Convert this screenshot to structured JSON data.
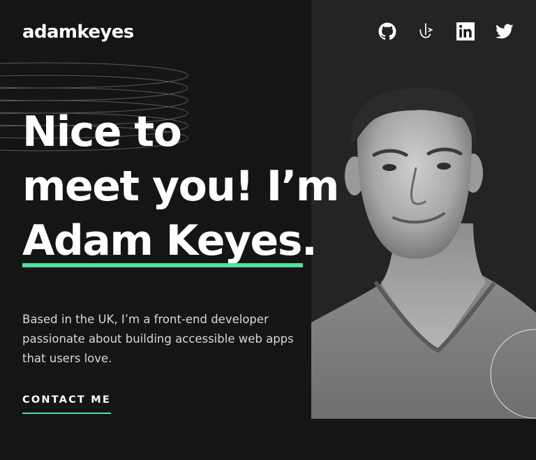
{
  "header": {
    "logo": "adamkeyes",
    "social_links": [
      {
        "name": "GitHub",
        "icon": "github-icon"
      },
      {
        "name": "Frontend Mentor",
        "icon": "frontend-mentor-icon"
      },
      {
        "name": "LinkedIn",
        "icon": "linkedin-icon"
      },
      {
        "name": "Twitter",
        "icon": "twitter-icon"
      }
    ]
  },
  "hero": {
    "headline_line1": "Nice to",
    "headline_line2": "meet you! I’m",
    "headline_name": "Adam Keyes",
    "headline_period": ".",
    "bio": "Based in the UK, I’m a front-end developer passionate about building accessible web apps that users love.",
    "cta_label": "CONTACT ME"
  },
  "colors": {
    "background": "#151515",
    "portrait_bg": "#242424",
    "accent": "#4ee1a0",
    "text": "#ffffff",
    "muted_text": "#d9d9d9"
  }
}
